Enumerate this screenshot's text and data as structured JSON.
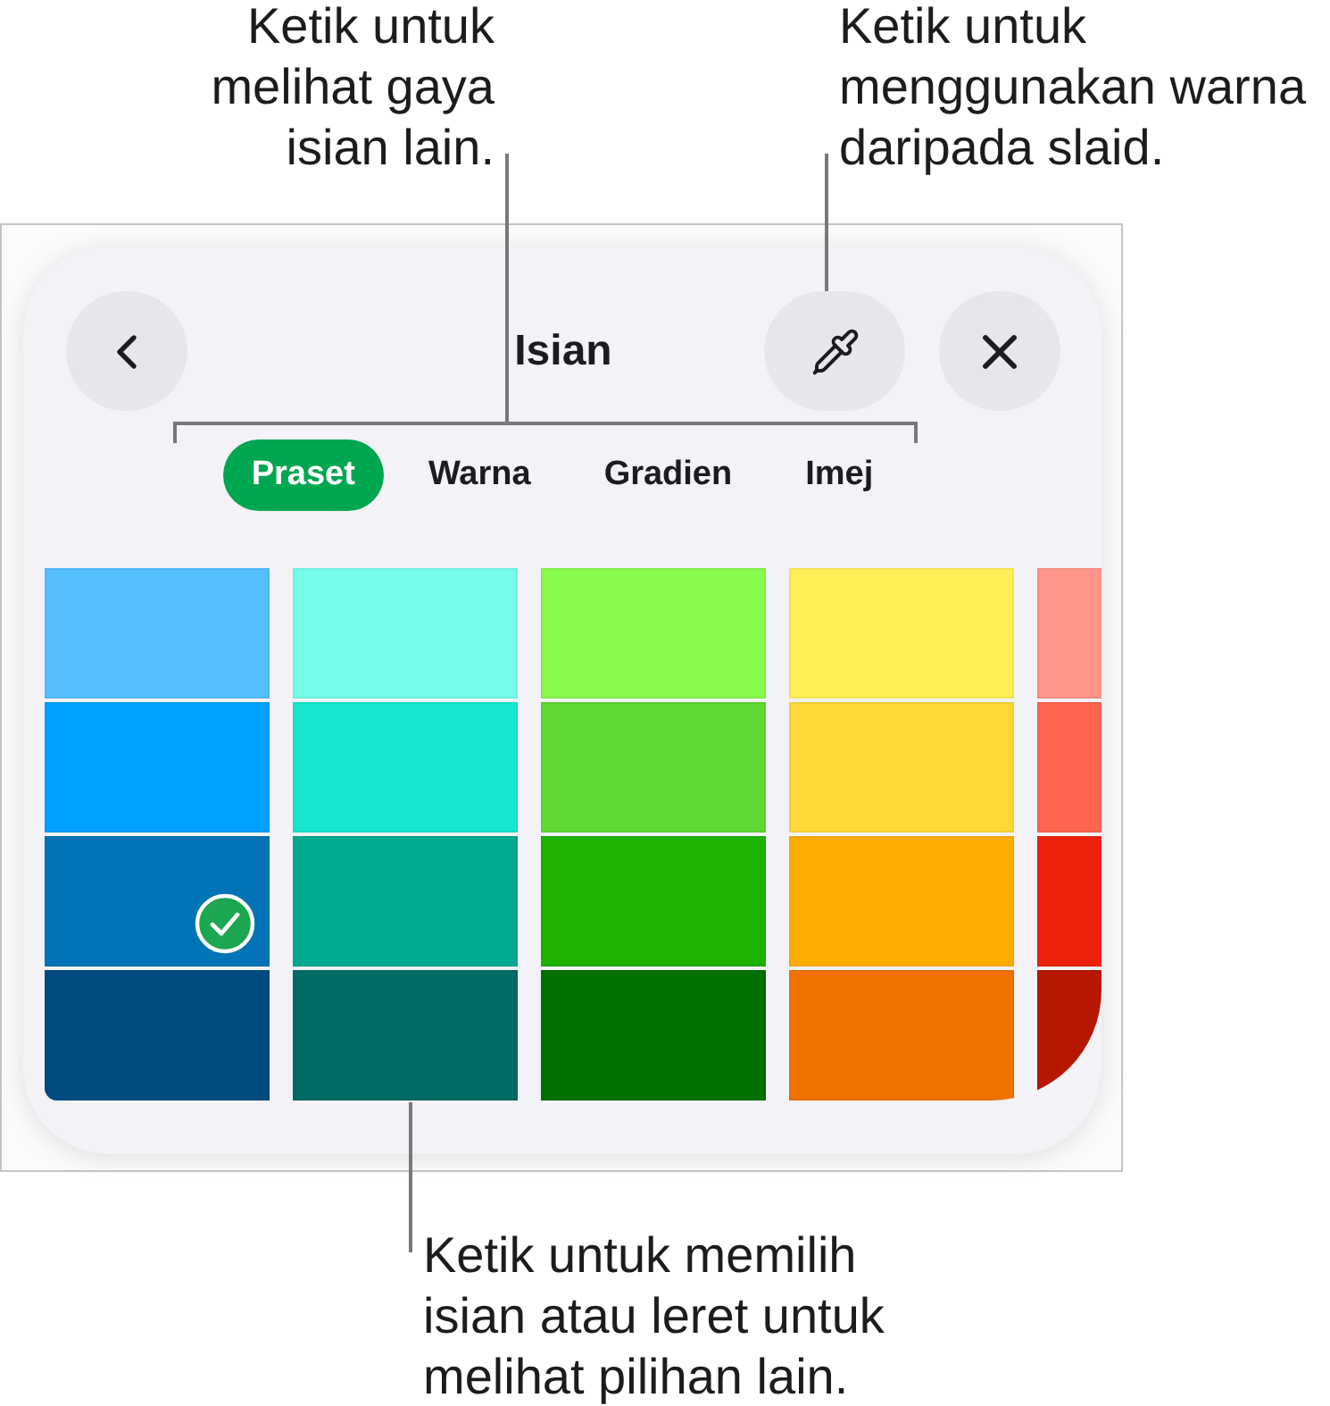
{
  "callouts": {
    "tabs": "Ketik untuk\nmelihat gaya\nisian lain.",
    "eyedropper": "Ketik untuk\nmenggunakan warna\ndaripada slaid.",
    "swatches": "Ketik untuk memilih\nisian atau leret untuk\nmelihat pilihan lain."
  },
  "panel": {
    "title": "Isian"
  },
  "tabs": [
    {
      "label": "Praset",
      "selected": true
    },
    {
      "label": "Warna",
      "selected": false
    },
    {
      "label": "Gradien",
      "selected": false
    },
    {
      "label": "Imej",
      "selected": false
    }
  ],
  "swatch_columns": [
    {
      "swatches": [
        {
          "color": "#56c0fe",
          "selected": false
        },
        {
          "color": "#00a2ff",
          "selected": false
        },
        {
          "color": "#0074b7",
          "selected": true
        },
        {
          "color": "#004c80",
          "selected": false
        }
      ]
    },
    {
      "swatches": [
        {
          "color": "#75fce9",
          "selected": false
        },
        {
          "color": "#16e8d0",
          "selected": false
        },
        {
          "color": "#00aa8e",
          "selected": false
        },
        {
          "color": "#006c65",
          "selected": false
        }
      ]
    },
    {
      "swatches": [
        {
          "color": "#89fa4e",
          "selected": false
        },
        {
          "color": "#61d836",
          "selected": false
        },
        {
          "color": "#1db300",
          "selected": false
        },
        {
          "color": "#017100",
          "selected": false
        }
      ]
    },
    {
      "swatches": [
        {
          "color": "#fff058",
          "selected": false
        },
        {
          "color": "#fdd938",
          "selected": false
        },
        {
          "color": "#ffae00",
          "selected": false
        },
        {
          "color": "#f07200",
          "selected": false
        }
      ]
    },
    {
      "swatches": [
        {
          "color": "#ff958a"
        },
        {
          "color": "#ff644e"
        },
        {
          "color": "#ee220c"
        },
        {
          "color": "#b51700"
        }
      ]
    }
  ]
}
